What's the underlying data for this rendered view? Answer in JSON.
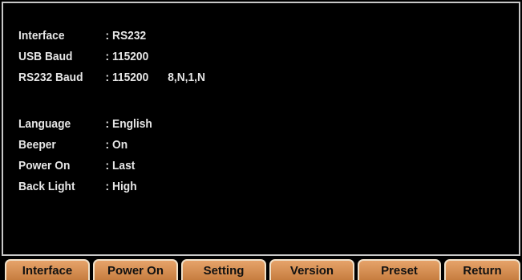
{
  "settings": [
    {
      "label": "Interface",
      "value": ": RS232",
      "extra": ""
    },
    {
      "label": "USB Baud",
      "value": ": 115200",
      "extra": ""
    },
    {
      "label": "RS232 Baud",
      "value": ": 115200",
      "extra": "8,N,1,N"
    },
    {
      "label": "Language",
      "value": ": English",
      "extra": ""
    },
    {
      "label": "Beeper",
      "value": ": On",
      "extra": ""
    },
    {
      "label": "Power On",
      "value": ": Last",
      "extra": ""
    },
    {
      "label": "Back Light",
      "value": ": High",
      "extra": ""
    }
  ],
  "softkeys": [
    "Interface",
    "Power On",
    "Setting",
    "Version",
    "Preset",
    "Return"
  ],
  "colors": {
    "background": "#000000",
    "text": "#e6e6e6",
    "softkey": "#d08a4c",
    "border": "#c8c8c8"
  }
}
